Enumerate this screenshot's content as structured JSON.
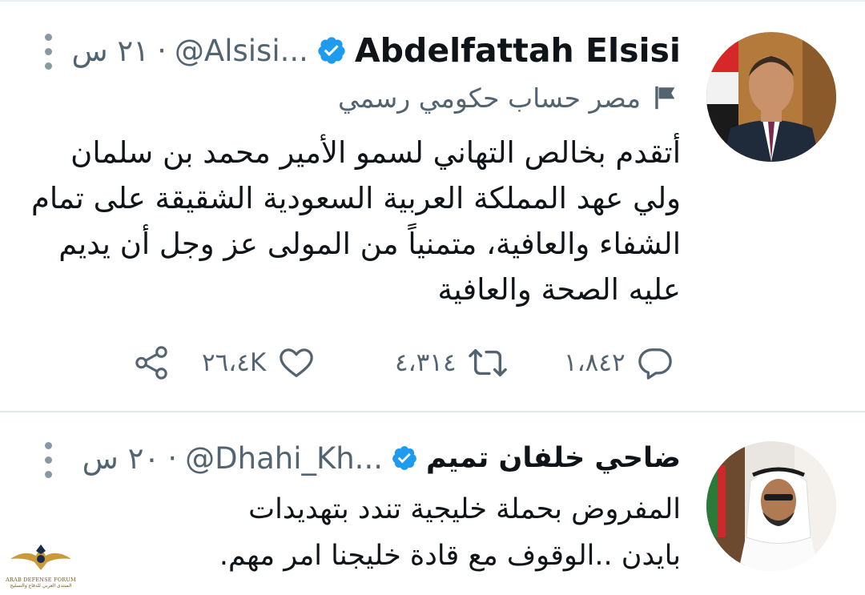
{
  "tweets": [
    {
      "name": "Abdelfattah Elsisi",
      "handle": "@Alsisi...",
      "separator": "·",
      "time": "٢١ س",
      "label": "مصر حساب حكومي رسمي",
      "text_lines": [
        "أتقدم بخالص التهاني لسمو الأمير محمد بن سلمان",
        "ولي عهد المملكة العربية السعودية الشقيقة على تمام",
        "الشفاء والعافية، متمنياً من المولى عز وجل أن يديم",
        "عليه الصحة والعافية"
      ],
      "replies": "١،٨٤٢",
      "retweets": "٤،٣١٤",
      "likes": "٢٦،٤K"
    },
    {
      "name": "ضاحي خلفان تميم",
      "handle": "@Dhahi_Kh...",
      "separator": "·",
      "time": "٢٠ س",
      "text_lines": [
        "المفروض بحملة خليجية تندد بتهديدات",
        "بايدن ..الوقوف مع قادة  خليجنا امر مهم."
      ]
    }
  ],
  "icons": {
    "verified": "verified-badge-icon",
    "government_label": "flag-icon",
    "more": "more-vertical-icon",
    "reply": "reply-icon",
    "retweet": "retweet-icon",
    "like": "heart-icon",
    "share": "share-icon"
  },
  "colors": {
    "verified_blue": "#1d9bf0",
    "muted": "#536471",
    "text": "#0f1419"
  },
  "watermark": {
    "line1": "ARAB DEFENSE FORUM",
    "line2": "المنتدى العربي للدفاع والتسليح"
  }
}
